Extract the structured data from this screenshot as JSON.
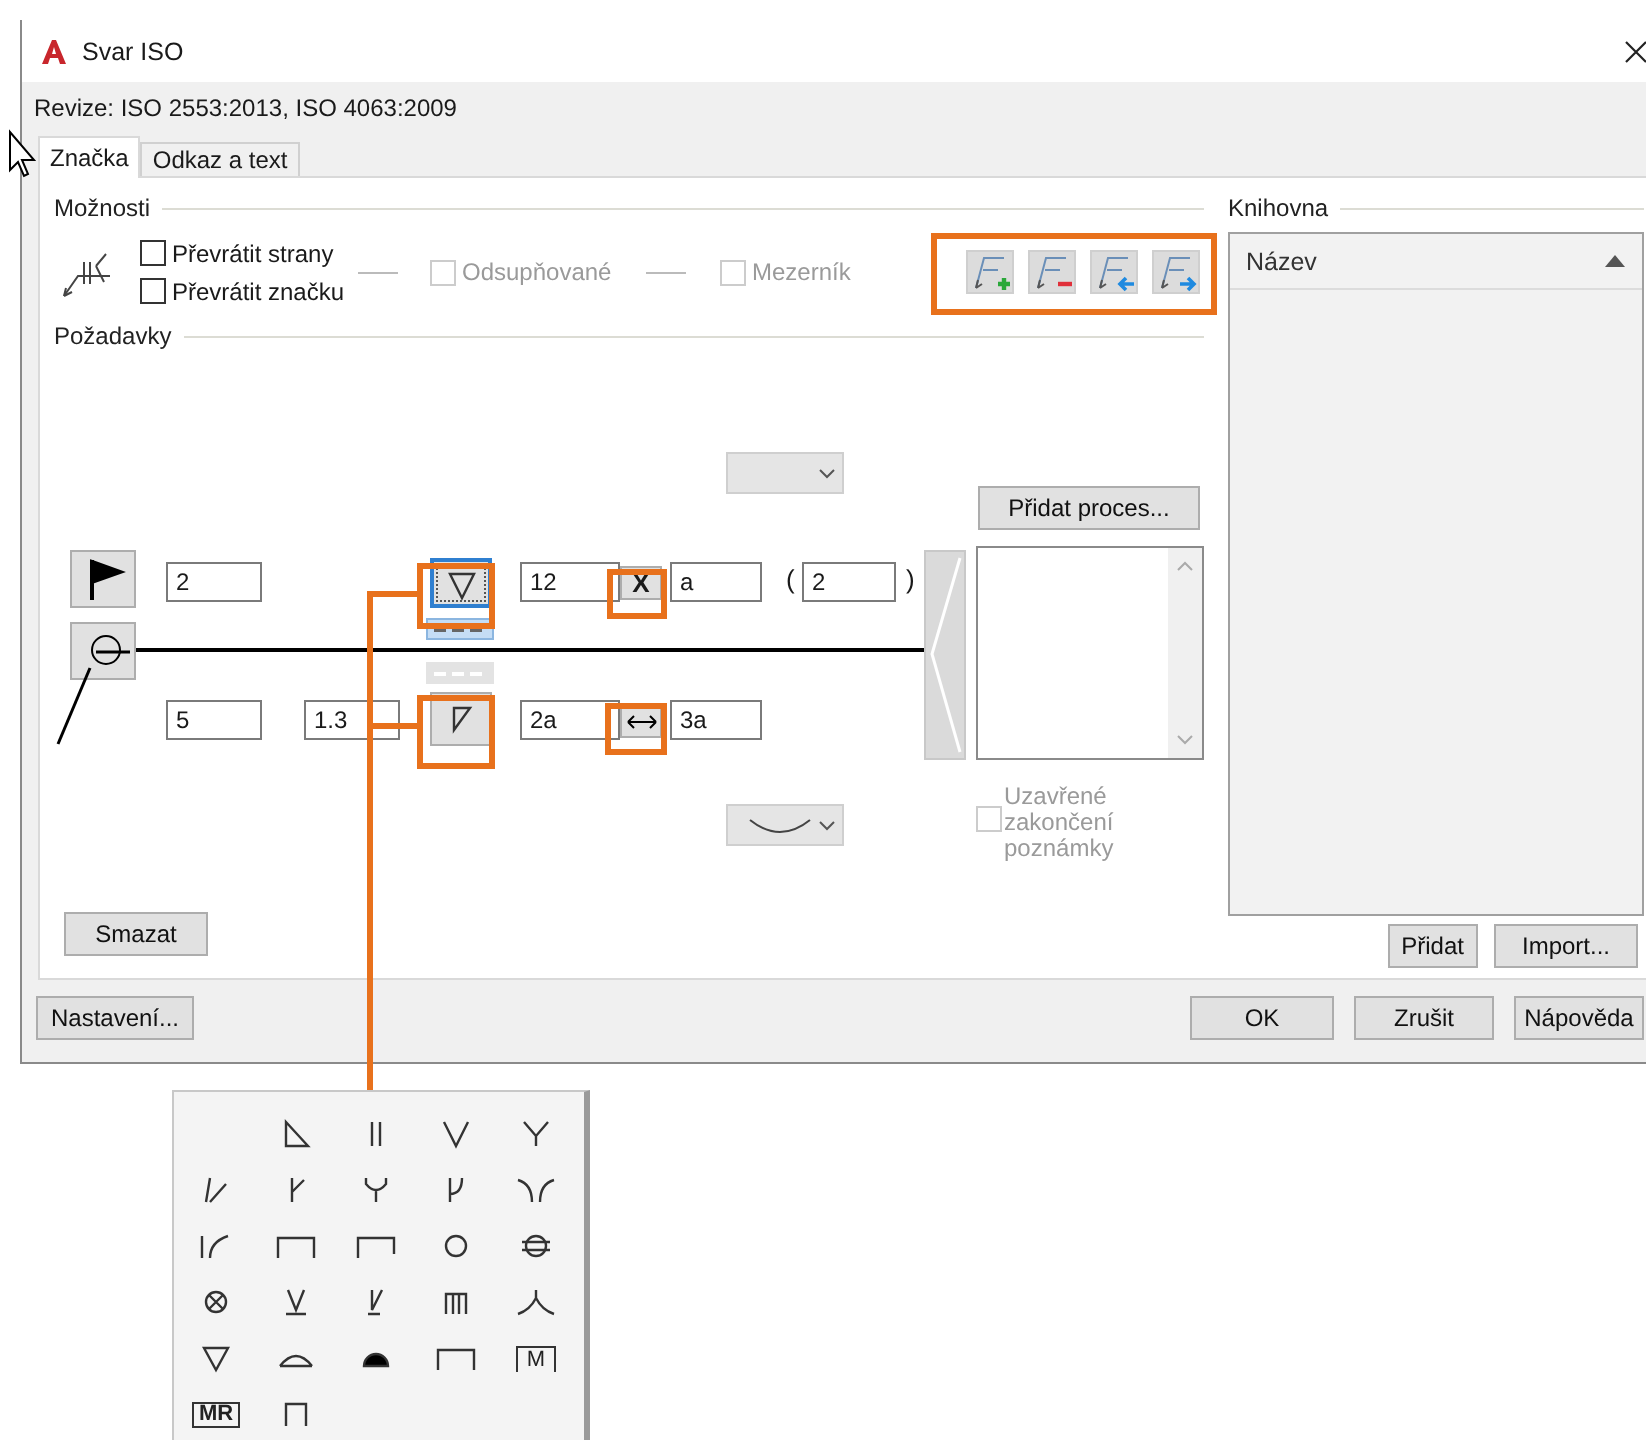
{
  "window": {
    "title": "Svar ISO"
  },
  "revision": "Revize: ISO 2553:2013, ISO 4063:2009",
  "tabs": [
    {
      "label": "Značka",
      "selected": true
    },
    {
      "label": "Odkaz a text",
      "selected": false
    }
  ],
  "options": {
    "heading": "Možnosti",
    "checkboxes": [
      {
        "label": "Převrátit strany",
        "checked": false,
        "disabled": false
      },
      {
        "label": "Převrátit značku",
        "checked": false,
        "disabled": false
      },
      {
        "label": "Odsupňované",
        "checked": false,
        "disabled": true
      },
      {
        "label": "Mezerník",
        "checked": false,
        "disabled": true
      }
    ],
    "tool_buttons": [
      {
        "kind": "add"
      },
      {
        "kind": "remove"
      },
      {
        "kind": "move-left"
      },
      {
        "kind": "move-right"
      }
    ]
  },
  "requirements": {
    "heading": "Požadavky",
    "contour_dropdowns": [
      {
        "kind": "none"
      },
      {
        "kind": "concave"
      }
    ],
    "arrow_side": {
      "prefix": "2",
      "symbol": {
        "kind": "fillet",
        "selected": true
      },
      "identification_line_selected": true,
      "size": "12",
      "modifier": {
        "kind": "text",
        "text": "X"
      },
      "length": "a",
      "open_paren": "(",
      "count": "2",
      "close_paren": ")"
    },
    "other_side": {
      "prefix": "5",
      "prefix_2": "1.3",
      "symbol": {
        "kind": "fillet-half",
        "selected": false
      },
      "identification_line_selected": false,
      "size": "2a",
      "modifier": {
        "kind": "arrows"
      },
      "length": "3a"
    },
    "add_process_button": "Přidat proces...",
    "closed_tail": {
      "label": "Uzavřené zakončení poznámky",
      "checked": false,
      "disabled": true
    },
    "clear_button": "Smazat"
  },
  "library": {
    "heading": "Knihovna",
    "column": "Název",
    "buttons": [
      "Přidat",
      "Import..."
    ]
  },
  "footer": {
    "settings_button": "Nastavení...",
    "buttons": [
      "OK",
      "Zrušit",
      "Nápověda"
    ]
  },
  "symbol_palette": {
    "symbols": [
      {
        "kind": "empty"
      },
      {
        "kind": "fillet-flat"
      },
      {
        "kind": "square"
      },
      {
        "kind": "v"
      },
      {
        "kind": "y"
      },
      {
        "kind": "bevel"
      },
      {
        "kind": "bevel-root"
      },
      {
        "kind": "u"
      },
      {
        "kind": "j"
      },
      {
        "kind": "flare-v"
      },
      {
        "kind": "flare-bevel"
      },
      {
        "kind": "edge"
      },
      {
        "kind": "corner"
      },
      {
        "kind": "spot"
      },
      {
        "kind": "seam"
      },
      {
        "kind": "plug"
      },
      {
        "kind": "v-backing"
      },
      {
        "kind": "bevel-backing"
      },
      {
        "kind": "stud"
      },
      {
        "kind": "flare"
      },
      {
        "kind": "fillet"
      },
      {
        "kind": "surfacing"
      },
      {
        "kind": "backing-fill"
      },
      {
        "kind": "box"
      },
      {
        "kind": "text",
        "text": "M"
      },
      {
        "kind": "text-box",
        "text": "MR"
      },
      {
        "kind": "small-box"
      }
    ]
  }
}
